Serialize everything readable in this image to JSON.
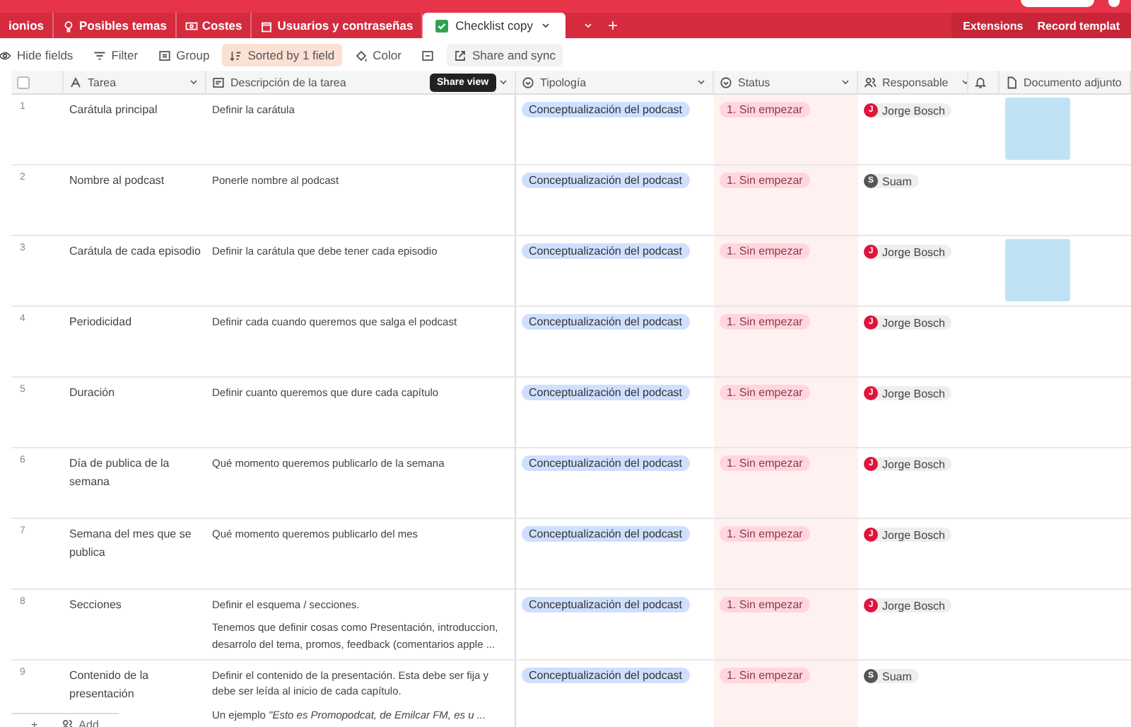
{
  "tabs": [
    {
      "label": "ionios",
      "selected": false
    },
    {
      "label": "Posibles temas",
      "selected": false
    },
    {
      "label": "Costes",
      "selected": false
    },
    {
      "label": "Usuarios y contraseñas",
      "selected": false
    },
    {
      "label": "Checklist copy",
      "selected": true
    }
  ],
  "add_tab": "+",
  "header_links": [
    "Extensions",
    "Record templat"
  ],
  "toolbar": [
    {
      "label": "Hide fields",
      "active": false
    },
    {
      "label": "Filter",
      "active": false
    },
    {
      "label": "Group",
      "active": false
    },
    {
      "label": "Sorted by 1 field",
      "active": true
    },
    {
      "label": "Color",
      "active": false
    },
    {
      "active": false
    },
    {
      "label": "Share and sync",
      "active": false
    }
  ],
  "tooltip": "Share view",
  "table": {
    "select_all": {
      "checked": false
    },
    "columns": [
      {
        "label": "Tarea"
      },
      {
        "label": "Descripción de la tarea"
      },
      {
        "label": "Tipología"
      },
      {
        "label": "Status"
      },
      {
        "label": "Responsable"
      },
      {},
      {
        "label": "Documento adjunto"
      }
    ],
    "rows": [
      {
        "number": "1",
        "tarea": "Carátula principal",
        "descripcion": [
          "Definir la carátula"
        ],
        "tipologia": "Conceptualización del podcast",
        "status": "1. Sin empezar",
        "responsable": {
          "initial": "J",
          "name": "Jorge Bosch",
          "color": "#e0133c"
        },
        "attachment": true
      },
      {
        "number": "2",
        "tarea": "Nombre al podcast",
        "descripcion": [
          "Ponerle nombre al podcast"
        ],
        "tipologia": "Conceptualización del podcast",
        "status": "1. Sin empezar",
        "responsable": {
          "initial": "S",
          "name": "Suam",
          "color": "#555555"
        },
        "attachment": false
      },
      {
        "number": "3",
        "tarea": "Carátula de cada episodio",
        "descripcion": [
          "Definir la carátula que debe tener cada episodio"
        ],
        "tipologia": "Conceptualización del podcast",
        "status": "1. Sin empezar",
        "responsable": {
          "initial": "J",
          "name": "Jorge Bosch",
          "color": "#e0133c"
        },
        "attachment": true
      },
      {
        "number": "4",
        "tarea": "Periodicidad",
        "descripcion": [
          "Definir cada cuando queremos que salga el podcast"
        ],
        "tipologia": "Conceptualización del podcast",
        "status": "1. Sin empezar",
        "responsable": {
          "initial": "J",
          "name": "Jorge Bosch",
          "color": "#e0133c"
        },
        "attachment": false
      },
      {
        "number": "5",
        "tarea": "Duración",
        "descripcion": [
          "Definir cuanto queremos que dure cada capítulo"
        ],
        "tipologia": "Conceptualización del podcast",
        "status": "1. Sin empezar",
        "responsable": {
          "initial": "J",
          "name": "Jorge Bosch",
          "color": "#e0133c"
        },
        "attachment": false
      },
      {
        "number": "6",
        "tarea": "Día de publica de la semana",
        "descripcion": [
          "Qué momento queremos publicarlo de la semana"
        ],
        "tipologia": "Conceptualización del podcast",
        "status": "1. Sin empezar",
        "responsable": {
          "initial": "J",
          "name": "Jorge Bosch",
          "color": "#e0133c"
        },
        "attachment": false
      },
      {
        "number": "7",
        "tarea": "Semana del mes que se publica",
        "descripcion": [
          "Qué momento queremos publicarlo del mes"
        ],
        "tipologia": "Conceptualización del podcast",
        "status": "1. Sin empezar",
        "responsable": {
          "initial": "J",
          "name": "Jorge Bosch",
          "color": "#e0133c"
        },
        "attachment": false
      },
      {
        "number": "8",
        "tarea": "Secciones",
        "descripcion": [
          "Definir el esquema / secciones.",
          "Tenemos que definir cosas como Presentación, introduccion, desarrolo del tema, promos, feedback (comentarios apple ..."
        ],
        "tipologia": "Conceptualización del podcast",
        "status": "1. Sin empezar",
        "responsable": {
          "initial": "J",
          "name": "Jorge Bosch",
          "color": "#e0133c"
        },
        "attachment": false
      },
      {
        "number": "9",
        "tarea": "Contenido de la presentación",
        "descripcion": [
          "Definir el contenido de la presentación. Esta debe ser fija y debe ser leída al inicio de cada capítulo.",
          "Un ejemplo *\"Esto es Promopodcat, de Emilcar FM, es u ...*"
        ],
        "tipologia": "Conceptualización del podcast",
        "status": "1. Sin empezar",
        "responsable": {
          "initial": "S",
          "name": "Suam",
          "color": "#555555"
        },
        "attachment": false
      }
    ]
  },
  "footer": {
    "add_row": "+",
    "add_label": "Add"
  }
}
